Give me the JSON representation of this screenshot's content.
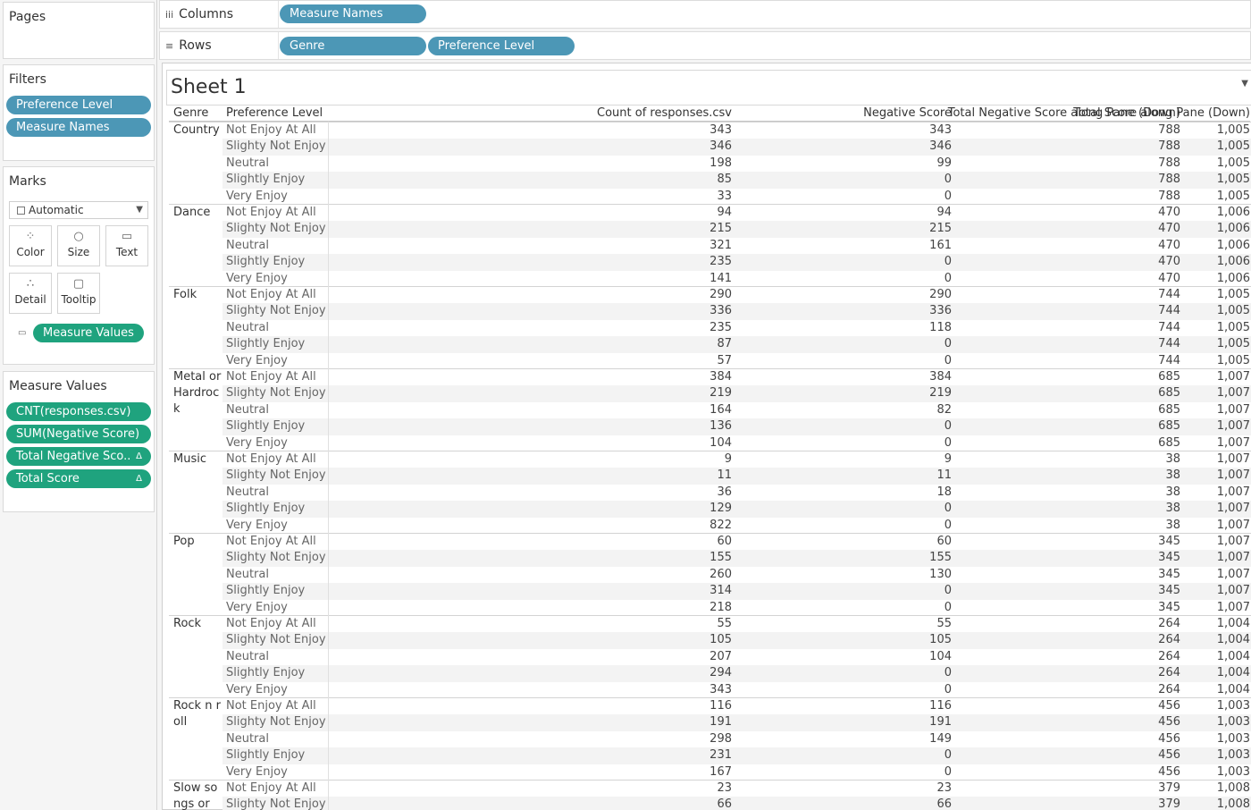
{
  "pages": {
    "title": "Pages"
  },
  "columns": {
    "label": "Columns",
    "pills": [
      "Measure Names"
    ]
  },
  "rows": {
    "label": "Rows",
    "pills": [
      "Genre",
      "Preference Level"
    ]
  },
  "filters": {
    "title": "Filters",
    "pills": [
      "Preference Level",
      "Measure Names"
    ]
  },
  "marks": {
    "title": "Marks",
    "type": "Automatic",
    "buttons": [
      {
        "label": "Color",
        "icon": "color-icon"
      },
      {
        "label": "Size",
        "icon": "size-icon"
      },
      {
        "label": "Text",
        "icon": "text-icon"
      },
      {
        "label": "Detail",
        "icon": "detail-icon"
      },
      {
        "label": "Tooltip",
        "icon": "tooltip-icon"
      }
    ],
    "text_pill": "Measure Values"
  },
  "measure_values": {
    "title": "Measure Values",
    "pills": [
      "CNT(responses.csv)",
      "SUM(Negative Score)",
      "Total Negative Sco..",
      "Total Score"
    ],
    "delta_symbol": "Δ"
  },
  "sheet": {
    "title": "Sheet 1",
    "headers": {
      "genre": "Genre",
      "pref": "Preference Level",
      "c1": "Count of responses.csv",
      "c2": "Negative Score",
      "c3": "Total Negative Score along Pane (Down)",
      "c4": "Total Score along Pane (Down)"
    },
    "groups": [
      {
        "genre": "Country",
        "rows": [
          [
            "Not Enjoy At All",
            "343",
            "343",
            "788",
            "1,005"
          ],
          [
            "Slighty Not Enjoy",
            "346",
            "346",
            "788",
            "1,005"
          ],
          [
            "Neutral",
            "198",
            "99",
            "788",
            "1,005"
          ],
          [
            "Slightly Enjoy",
            "85",
            "0",
            "788",
            "1,005"
          ],
          [
            "Very Enjoy",
            "33",
            "0",
            "788",
            "1,005"
          ]
        ]
      },
      {
        "genre": "Dance",
        "rows": [
          [
            "Not Enjoy At All",
            "94",
            "94",
            "470",
            "1,006"
          ],
          [
            "Slighty Not Enjoy",
            "215",
            "215",
            "470",
            "1,006"
          ],
          [
            "Neutral",
            "321",
            "161",
            "470",
            "1,006"
          ],
          [
            "Slightly Enjoy",
            "235",
            "0",
            "470",
            "1,006"
          ],
          [
            "Very Enjoy",
            "141",
            "0",
            "470",
            "1,006"
          ]
        ]
      },
      {
        "genre": "Folk",
        "rows": [
          [
            "Not Enjoy At All",
            "290",
            "290",
            "744",
            "1,005"
          ],
          [
            "Slighty Not Enjoy",
            "336",
            "336",
            "744",
            "1,005"
          ],
          [
            "Neutral",
            "235",
            "118",
            "744",
            "1,005"
          ],
          [
            "Slightly Enjoy",
            "87",
            "0",
            "744",
            "1,005"
          ],
          [
            "Very Enjoy",
            "57",
            "0",
            "744",
            "1,005"
          ]
        ]
      },
      {
        "genre": "Metal or Hardrock",
        "rows": [
          [
            "Not Enjoy At All",
            "384",
            "384",
            "685",
            "1,007"
          ],
          [
            "Slighty Not Enjoy",
            "219",
            "219",
            "685",
            "1,007"
          ],
          [
            "Neutral",
            "164",
            "82",
            "685",
            "1,007"
          ],
          [
            "Slightly Enjoy",
            "136",
            "0",
            "685",
            "1,007"
          ],
          [
            "Very Enjoy",
            "104",
            "0",
            "685",
            "1,007"
          ]
        ]
      },
      {
        "genre": "Music",
        "rows": [
          [
            "Not Enjoy At All",
            "9",
            "9",
            "38",
            "1,007"
          ],
          [
            "Slighty Not Enjoy",
            "11",
            "11",
            "38",
            "1,007"
          ],
          [
            "Neutral",
            "36",
            "18",
            "38",
            "1,007"
          ],
          [
            "Slightly Enjoy",
            "129",
            "0",
            "38",
            "1,007"
          ],
          [
            "Very Enjoy",
            "822",
            "0",
            "38",
            "1,007"
          ]
        ]
      },
      {
        "genre": "Pop",
        "rows": [
          [
            "Not Enjoy At All",
            "60",
            "60",
            "345",
            "1,007"
          ],
          [
            "Slighty Not Enjoy",
            "155",
            "155",
            "345",
            "1,007"
          ],
          [
            "Neutral",
            "260",
            "130",
            "345",
            "1,007"
          ],
          [
            "Slightly Enjoy",
            "314",
            "0",
            "345",
            "1,007"
          ],
          [
            "Very Enjoy",
            "218",
            "0",
            "345",
            "1,007"
          ]
        ]
      },
      {
        "genre": "Rock",
        "rows": [
          [
            "Not Enjoy At All",
            "55",
            "55",
            "264",
            "1,004"
          ],
          [
            "Slighty Not Enjoy",
            "105",
            "105",
            "264",
            "1,004"
          ],
          [
            "Neutral",
            "207",
            "104",
            "264",
            "1,004"
          ],
          [
            "Slightly Enjoy",
            "294",
            "0",
            "264",
            "1,004"
          ],
          [
            "Very Enjoy",
            "343",
            "0",
            "264",
            "1,004"
          ]
        ]
      },
      {
        "genre": "Rock n roll",
        "rows": [
          [
            "Not Enjoy At All",
            "116",
            "116",
            "456",
            "1,003"
          ],
          [
            "Slighty Not Enjoy",
            "191",
            "191",
            "456",
            "1,003"
          ],
          [
            "Neutral",
            "298",
            "149",
            "456",
            "1,003"
          ],
          [
            "Slightly Enjoy",
            "231",
            "0",
            "456",
            "1,003"
          ],
          [
            "Very Enjoy",
            "167",
            "0",
            "456",
            "1,003"
          ]
        ]
      },
      {
        "genre": "Slow songs or",
        "rows": [
          [
            "Not Enjoy At All",
            "23",
            "23",
            "379",
            "1,008"
          ],
          [
            "Slighty Not Enjoy",
            "66",
            "66",
            "379",
            "1,008"
          ]
        ]
      }
    ]
  }
}
